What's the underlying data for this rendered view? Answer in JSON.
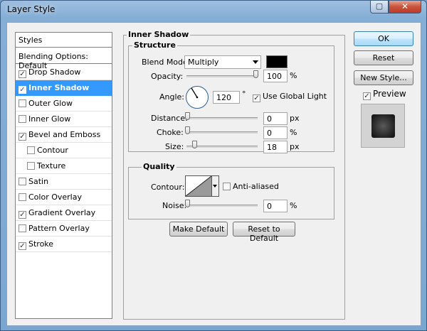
{
  "window": {
    "title": "Layer Style",
    "help_icon": "restore-icon",
    "close_icon": "close-icon"
  },
  "styles": {
    "header": "Styles",
    "blending_options": "Blending Options: Default",
    "items": [
      {
        "label": "Drop Shadow",
        "checked": true
      },
      {
        "label": "Inner Shadow",
        "checked": true,
        "selected": true
      },
      {
        "label": "Outer Glow",
        "checked": false
      },
      {
        "label": "Inner Glow",
        "checked": false
      },
      {
        "label": "Bevel and Emboss",
        "checked": true
      },
      {
        "label": "Contour",
        "checked": false,
        "sub": true
      },
      {
        "label": "Texture",
        "checked": false,
        "sub": true
      },
      {
        "label": "Satin",
        "checked": false
      },
      {
        "label": "Color Overlay",
        "checked": false
      },
      {
        "label": "Gradient Overlay",
        "checked": true
      },
      {
        "label": "Pattern Overlay",
        "checked": false
      },
      {
        "label": "Stroke",
        "checked": true
      }
    ]
  },
  "panel": {
    "section_title": "Inner Shadow",
    "structure_title": "Structure",
    "blend_mode_label": "Blend Mode:",
    "blend_mode_value": "Multiply",
    "blend_color": "#000000",
    "opacity_label": "Opacity:",
    "opacity_value": "100",
    "opacity_unit": "%",
    "opacity_level": 1.0,
    "angle_label": "Angle:",
    "angle_value": "120",
    "angle_unit": "°",
    "use_global_light_label": "Use Global Light",
    "use_global_light_checked": true,
    "distance_label": "Distance:",
    "distance_value": "0",
    "distance_unit": "px",
    "choke_label": "Choke:",
    "choke_value": "0",
    "choke_unit": "%",
    "size_label": "Size:",
    "size_value": "18",
    "size_unit": "px",
    "quality_title": "Quality",
    "contour_label": "Contour:",
    "anti_aliased_label": "Anti-aliased",
    "anti_aliased_checked": false,
    "noise_label": "Noise:",
    "noise_value": "0",
    "noise_unit": "%",
    "make_default_label": "Make Default",
    "reset_default_label": "Reset to Default"
  },
  "actions": {
    "ok_label": "OK",
    "reset_label": "Reset",
    "new_style_label": "New Style...",
    "preview_label": "Preview",
    "preview_checked": true
  }
}
